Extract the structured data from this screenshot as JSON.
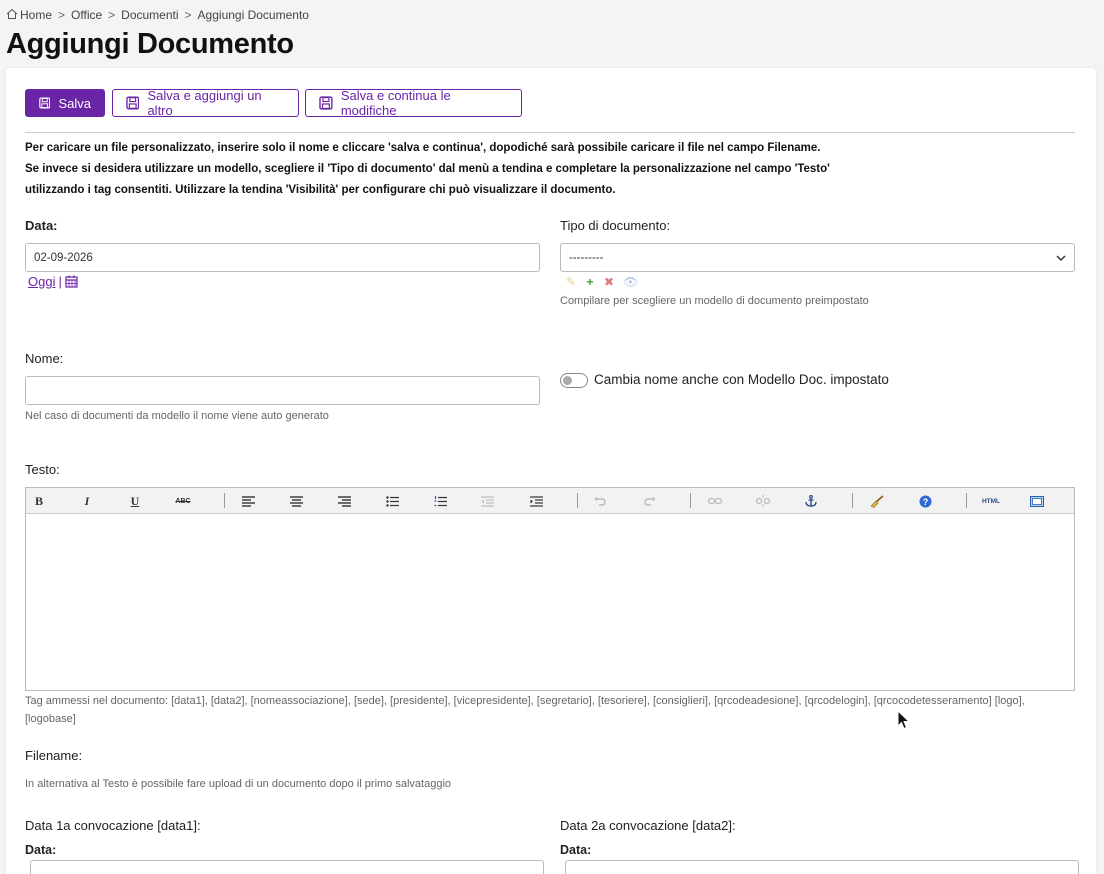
{
  "breadcrumb": {
    "items": [
      "Home",
      "Office",
      "Documenti",
      "Aggiungi Documento"
    ],
    "separator": ">"
  },
  "page_title": "Aggiungi Documento",
  "buttons": {
    "save": "Salva",
    "save_add": "Salva e aggiungi un altro",
    "save_continue": "Salva e continua le modifiche"
  },
  "intro": {
    "line1": "Per caricare un file personalizzato, inserire solo il nome e cliccare 'salva e continua', dopodiché sarà possibile caricare il file nel campo Filename.",
    "line2": "Se invece si desidera utilizzare un modello, scegliere il 'Tipo di documento' dal menù a tendina e completare la personalizzazione nel campo 'Testo'",
    "line3": "utilizzando i tag consentiti. Utilizzare la tendina 'Visibilità' per configurare chi può visualizzare il documento."
  },
  "data_field": {
    "label": "Data:",
    "value": "02-09-2026",
    "today_link": "Oggi",
    "pipe": "|"
  },
  "tipo_documento": {
    "label": "Tipo di documento:",
    "selected": "---------",
    "help": "Compilare per scegliere un modello di documento preimpostato"
  },
  "nome": {
    "label": "Nome:",
    "value": "",
    "help": "Nel caso di documenti da modello il nome viene auto generato"
  },
  "toggle": {
    "label": "Cambia nome anche con Modello Doc. impostato",
    "on": false
  },
  "testo": {
    "label": "Testo:",
    "toolbar": {
      "bold": "B",
      "italic": "I",
      "underline": "U",
      "strike": "ABC",
      "html": "HTML"
    },
    "help_line1": "Tag ammessi nel documento: [data1], [data2], [nomeassociazione], [sede], [presidente], [vicepresidente], [segretario], [tesoriere], [consiglieri], [qrcodeadesione], [qrcodelogin], [qrcocodetesseramento] [logo],",
    "help_line2": "[logobase]"
  },
  "filename": {
    "label": "Filename:",
    "help": "In alternativa al Testo è possibile fare upload di un documento dopo il primo salvataggio"
  },
  "convocazione1": {
    "label": "Data 1a convocazione [data1]:",
    "sub_label": "Data:"
  },
  "convocazione2": {
    "label": "Data 2a convocazione [data2]:",
    "sub_label": "Data:"
  },
  "colors": {
    "accent": "#6a24a6",
    "border": "#bbbbbb",
    "background": "#f4f4f5"
  }
}
